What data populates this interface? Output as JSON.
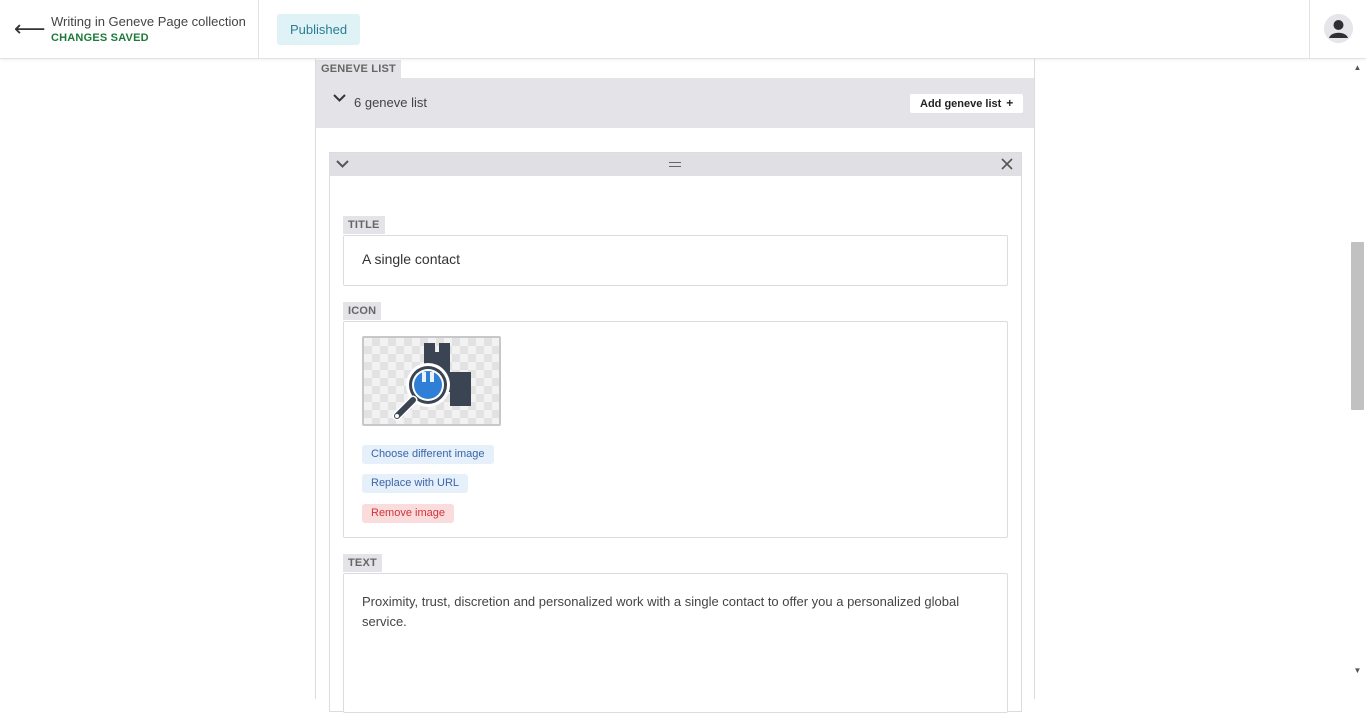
{
  "header": {
    "back_icon": "arrow-left-icon",
    "collection_title": "Writing in Geneve Page collection",
    "save_status": "CHANGES SAVED",
    "publish_status": "Published",
    "avatar_icon": "user-avatar-icon"
  },
  "list": {
    "section_label": "GENEVE LIST",
    "count_label": "6 geneve list",
    "add_button_label": "Add geneve list",
    "add_button_icon": "+"
  },
  "item": {
    "collapse_icon": "chevron-down-icon",
    "drag_icon": "drag-handle-icon",
    "close_icon": "close-icon",
    "title_label": "TITLE",
    "title_value": "A single contact",
    "icon_label": "ICON",
    "icon_image": "magnifier-package-icon",
    "choose_image_label": "Choose different image",
    "replace_url_label": "Replace with URL",
    "remove_image_label": "Remove image",
    "text_label": "TEXT",
    "text_value": "Proximity, trust, discretion and personalized work with a single contact to offer you a personalized global service."
  },
  "colors": {
    "saved_green": "#1d7a3b",
    "badge_bg": "#dff3f7",
    "badge_text": "#2b7d93",
    "remove_red": "#d0343a",
    "link_blue": "#3b64a8",
    "icon_blue": "#2f7fd6",
    "icon_dark": "#3a4452"
  }
}
